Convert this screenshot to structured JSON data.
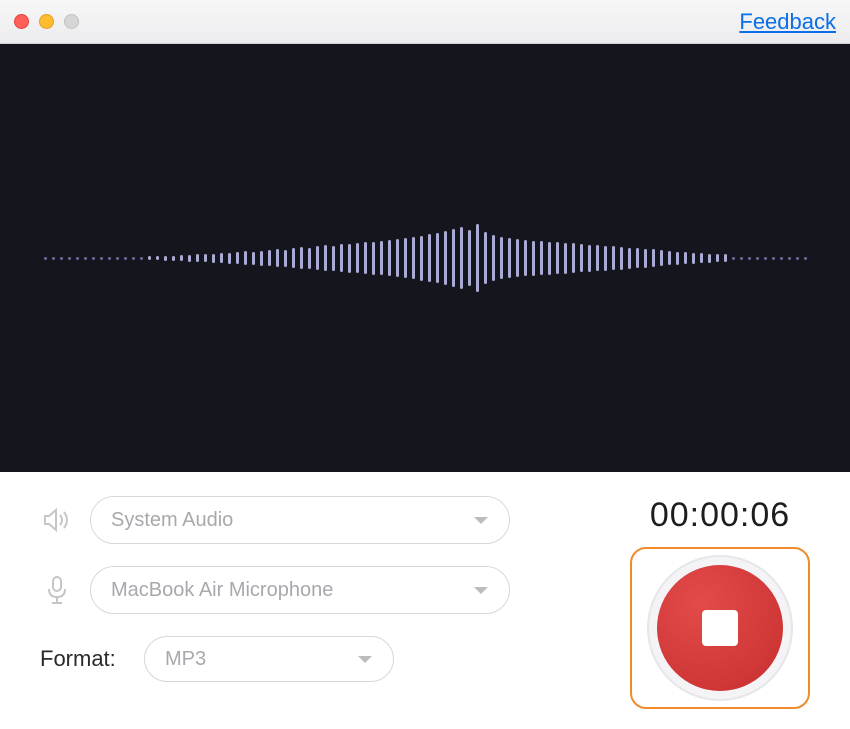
{
  "titlebar": {
    "feedback_label": "Feedback"
  },
  "audio_source": {
    "selected": "System Audio"
  },
  "mic_source": {
    "selected": "MacBook Air Microphone"
  },
  "format": {
    "label": "Format:",
    "selected": "MP3"
  },
  "timer": {
    "value": "00:00:06"
  },
  "waveform": {
    "heights": [
      3,
      3,
      3,
      3,
      3,
      3,
      3,
      3,
      3,
      3,
      3,
      3,
      3,
      4,
      4,
      5,
      5,
      6,
      7,
      8,
      8,
      9,
      10,
      11,
      12,
      14,
      13,
      15,
      16,
      18,
      17,
      20,
      22,
      21,
      24,
      26,
      25,
      28,
      29,
      30,
      32,
      33,
      34,
      36,
      38,
      40,
      42,
      45,
      48,
      50,
      54,
      58,
      62,
      56,
      68,
      52,
      46,
      42,
      40,
      38,
      36,
      35,
      34,
      33,
      32,
      31,
      30,
      28,
      27,
      26,
      25,
      24,
      23,
      21,
      20,
      19,
      18,
      16,
      14,
      13,
      12,
      11,
      10,
      9,
      8,
      8,
      3,
      3,
      3,
      3,
      3,
      3,
      3,
      3,
      3,
      3
    ]
  },
  "colors": {
    "accent_orange": "#f08a2a",
    "record_red": "#c72f2f",
    "link_blue": "#0a6fe8"
  }
}
